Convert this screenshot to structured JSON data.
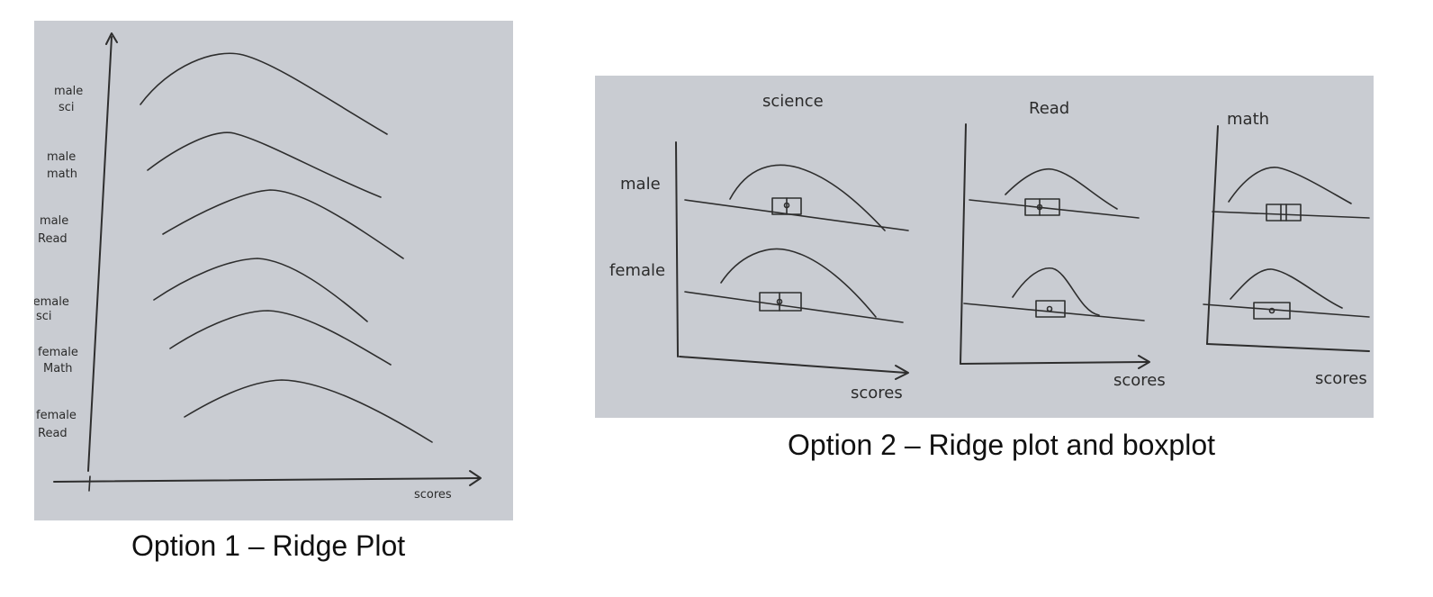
{
  "option1": {
    "caption": "Option 1 – Ridge Plot",
    "x_label": "scores",
    "rows": [
      {
        "line1": "male",
        "line2": "sci"
      },
      {
        "line1": "male",
        "line2": "math"
      },
      {
        "line1": "male",
        "line2": "Read"
      },
      {
        "line1": "female",
        "line2": "sci"
      },
      {
        "line1": "female",
        "line2": "Math"
      },
      {
        "line1": "female",
        "line2": "Read"
      }
    ]
  },
  "option2": {
    "caption": "Option 2 – Ridge plot and boxplot",
    "panels": [
      {
        "title": "science",
        "x_label": "scores"
      },
      {
        "title": "Read",
        "x_label": "scores"
      },
      {
        "title": "math",
        "x_label": "scores"
      }
    ],
    "row_labels": [
      "male",
      "female"
    ]
  },
  "colors": {
    "paper": "#c9ccd2",
    "ink": "#2e2e2e"
  }
}
